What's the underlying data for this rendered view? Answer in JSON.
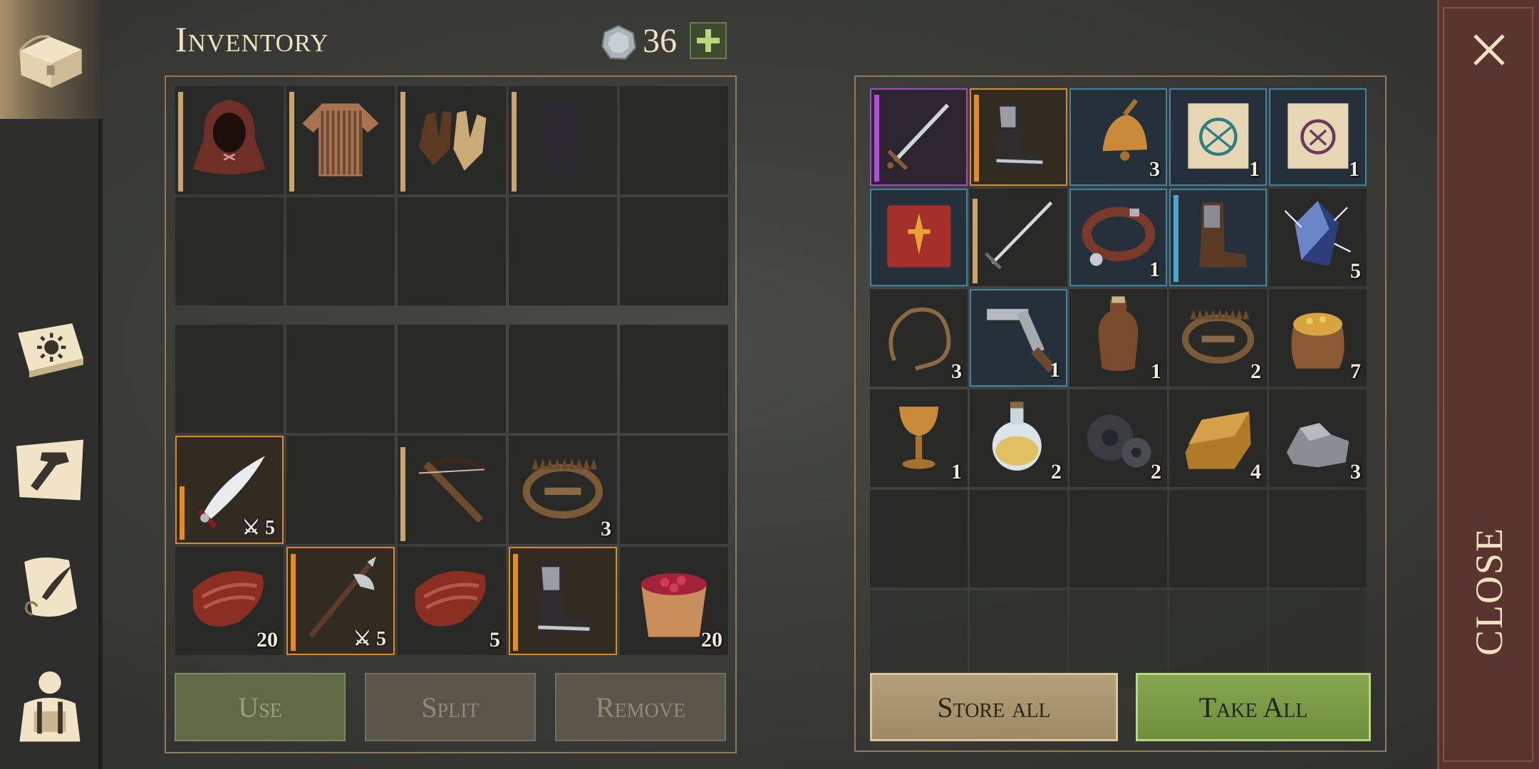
{
  "header": {
    "title": "Inventory",
    "coins": "36"
  },
  "nav": {
    "items": [
      {
        "name": "nav-chest",
        "icon": "chest-icon",
        "active": true
      },
      {
        "name": "nav-journal",
        "icon": "sun-book-icon",
        "active": false
      },
      {
        "name": "nav-crafting",
        "icon": "hammer-icon",
        "active": false
      },
      {
        "name": "nav-quests",
        "icon": "scroll-quill-icon",
        "active": false
      },
      {
        "name": "nav-character",
        "icon": "character-backpack-icon",
        "active": false
      }
    ]
  },
  "inventory": {
    "equipment": [
      {
        "icon": "hood-icon",
        "qty": "",
        "rarity": "common",
        "condition": 1.0
      },
      {
        "icon": "chainmail-shirt-icon",
        "qty": "",
        "rarity": "common",
        "condition": 1.0
      },
      {
        "icon": "leather-gloves-icon",
        "qty": "",
        "rarity": "common",
        "condition": 1.0
      },
      {
        "icon": "pants-icon",
        "qty": "",
        "rarity": "common",
        "condition": 1.0
      },
      null,
      null,
      null,
      null,
      null,
      null
    ],
    "backpack": [
      null,
      null,
      null,
      null,
      null,
      {
        "icon": "saber-icon",
        "qty": "5",
        "qty_type": "damage",
        "rarity": "orange",
        "condition": 0.55
      },
      null,
      {
        "icon": "crossbow-icon",
        "qty": "",
        "rarity": "common",
        "condition": 0.95
      },
      {
        "icon": "bear-trap-icon",
        "qty": "3",
        "rarity": "none"
      },
      null,
      {
        "icon": "raw-meat-icon",
        "qty": "20",
        "rarity": "none"
      },
      {
        "icon": "halberd-icon",
        "qty": "5",
        "qty_type": "damage",
        "rarity": "orange",
        "condition": 1.0
      },
      {
        "icon": "raw-meat-icon",
        "qty": "5",
        "rarity": "none"
      },
      {
        "icon": "iron-boots-icon",
        "qty": "",
        "rarity": "orange",
        "condition": 1.0
      },
      {
        "icon": "berry-bucket-icon",
        "qty": "20",
        "rarity": "none"
      }
    ]
  },
  "storage": {
    "items": [
      {
        "icon": "longsword-icon",
        "qty": "",
        "rarity": "purple",
        "condition": 1.0
      },
      {
        "icon": "iron-boots-icon",
        "qty": "",
        "rarity": "orange",
        "condition": 1.0
      },
      {
        "icon": "bell-icon",
        "qty": "3",
        "rarity": "blue"
      },
      {
        "icon": "blue-rune-scroll-icon",
        "qty": "1",
        "rarity": "blue"
      },
      {
        "icon": "purple-rune-scroll-icon",
        "qty": "1",
        "rarity": "blue"
      },
      {
        "icon": "dagger-book-icon",
        "qty": "",
        "rarity": "blue"
      },
      {
        "icon": "sword-icon",
        "qty": "",
        "rarity": "common",
        "condition": 0.95
      },
      {
        "icon": "dog-collar-icon",
        "qty": "1",
        "rarity": "blue"
      },
      {
        "icon": "leather-boots-icon",
        "qty": "",
        "rarity": "blue",
        "condition": 1.0
      },
      {
        "icon": "crystal-icon",
        "qty": "5",
        "rarity": "none"
      },
      {
        "icon": "rope-icon",
        "qty": "3",
        "rarity": "none"
      },
      {
        "icon": "crank-icon",
        "qty": "1",
        "rarity": "blue"
      },
      {
        "icon": "flask-icon",
        "qty": "1",
        "rarity": "none"
      },
      {
        "icon": "bear-trap-icon",
        "qty": "2",
        "rarity": "none"
      },
      {
        "icon": "grain-sack-icon",
        "qty": "7",
        "rarity": "none"
      },
      {
        "icon": "goblet-icon",
        "qty": "1",
        "rarity": "none"
      },
      {
        "icon": "potion-icon",
        "qty": "2",
        "rarity": "none"
      },
      {
        "icon": "gears-icon",
        "qty": "2",
        "rarity": "none"
      },
      {
        "icon": "gold-ingot-icon",
        "qty": "4",
        "rarity": "none"
      },
      {
        "icon": "stone-icon",
        "qty": "3",
        "rarity": "none"
      },
      null,
      null,
      null,
      null,
      null,
      null,
      null,
      null,
      null,
      null
    ]
  },
  "actions": {
    "use": "Use",
    "split": "Split",
    "remove": "Remove",
    "store_all": "Store all",
    "take_all": "Take All"
  },
  "close": {
    "label": "CLOSE"
  },
  "colors": {
    "orange": "#e48a22",
    "purple": "#b24ed6",
    "blue": "#48a8d0",
    "green_button": "#7a9a46",
    "close_bar": "#5a3530"
  }
}
